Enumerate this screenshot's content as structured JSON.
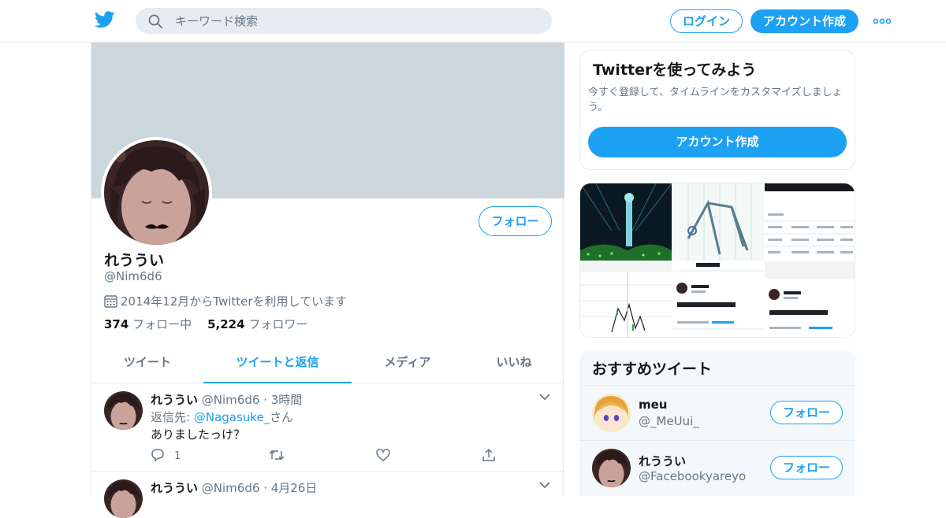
{
  "topbar": {
    "logo_icon": "twitter-bird-icon",
    "search_placeholder": "キーワード検索",
    "login_label": "ログイン",
    "signup_label": "アカウント作成",
    "more_icon": "more-dots-icon"
  },
  "profile": {
    "name": "れううい",
    "handle": "@Nim6d6",
    "joined": "2014年12月からTwitterを利用しています",
    "following_count": "374",
    "following_label": "フォロー中",
    "followers_count": "5,224",
    "followers_label": "フォロワー",
    "follow_label": "フォロー"
  },
  "tabs": [
    {
      "label": "ツイート"
    },
    {
      "label": "ツイートと返信",
      "active": true
    },
    {
      "label": "メディア"
    },
    {
      "label": "いいね"
    }
  ],
  "tweets": [
    {
      "name": "れううい",
      "handle": "@Nim6d6",
      "sep": "·",
      "time": "3時間",
      "reply_prefix": "返信先:",
      "reply_to": "@Nagasuke_",
      "reply_suffix": "さん",
      "text": "ありましたっけ？",
      "reply_count": "1"
    },
    {
      "name": "れううい",
      "handle": "@Nim6d6",
      "sep": "·",
      "time": "4月26日"
    }
  ],
  "signup_card": {
    "title": "Twitterを使ってみよう",
    "desc": "今すぐ登録して、タイムラインをカスタマイズしましょう。",
    "button": "アカウント作成"
  },
  "recommend": {
    "title": "おすすめツイート",
    "follow_label": "フォロー",
    "users": [
      {
        "name": "meu",
        "handle": "@_MeUui_"
      },
      {
        "name": "れううい",
        "handle": "@Facebookyareyo"
      }
    ]
  },
  "colors": {
    "accent": "#1da1f2",
    "banner": "#ccd6dd",
    "muted": "#657786"
  }
}
